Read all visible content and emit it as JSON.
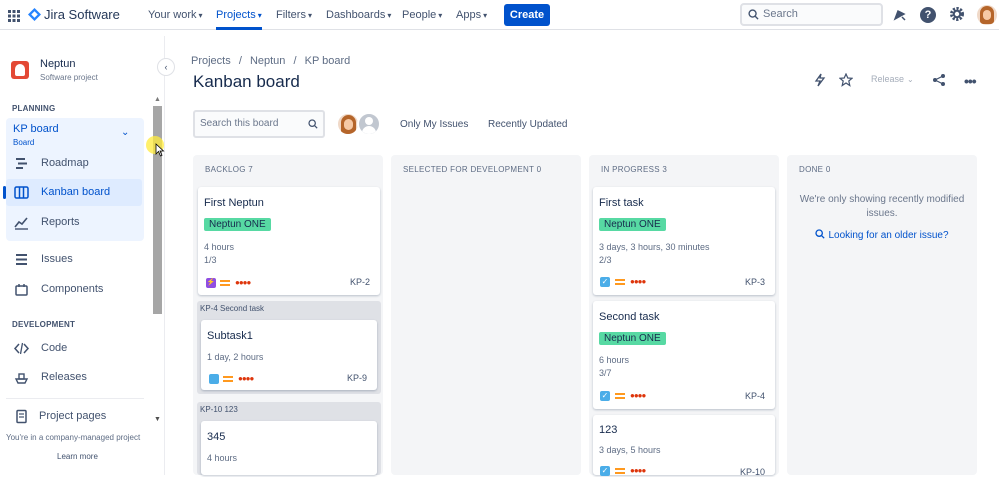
{
  "topnav": {
    "product": "Jira Software",
    "items": [
      {
        "label": "Your work"
      },
      {
        "label": "Projects"
      },
      {
        "label": "Filters"
      },
      {
        "label": "Dashboards"
      },
      {
        "label": "People"
      },
      {
        "label": "Apps"
      }
    ],
    "create_label": "Create",
    "search_placeholder": "Search"
  },
  "sidebar": {
    "project_name": "Neptun",
    "project_type": "Software project",
    "planning_heading": "PLANNING",
    "board_name": "KP board",
    "board_sub": "Board",
    "planning_items": [
      {
        "label": "Roadmap"
      },
      {
        "label": "Kanban board"
      },
      {
        "label": "Reports"
      }
    ],
    "other_items": [
      {
        "label": "Issues"
      },
      {
        "label": "Components"
      }
    ],
    "development_heading": "DEVELOPMENT",
    "development_items": [
      {
        "label": "Code"
      },
      {
        "label": "Releases"
      }
    ],
    "project_pages": "Project pages",
    "footer_note": "You're in a company-managed project",
    "learn_more": "Learn more"
  },
  "page": {
    "breadcrumb": [
      "Projects",
      "Neptun",
      "KP board"
    ],
    "title": "Kanban board",
    "release_label": "Release",
    "board_search_placeholder": "Search this board",
    "filter_only_mine": "Only My Issues",
    "filter_recent": "Recently Updated"
  },
  "columns": [
    {
      "name": "BACKLOG 7"
    },
    {
      "name": "SELECTED FOR DEVELOPMENT 0"
    },
    {
      "name": "IN PROGRESS 3"
    },
    {
      "name": "DONE 0"
    }
  ],
  "backlog": {
    "card1": {
      "title": "First Neptun",
      "epic": "Neptun ONE",
      "estimate": "4 hours",
      "progress": "1/3",
      "key": "KP-2"
    },
    "parent1": {
      "label": "KP-4 Second task",
      "title": "Subtask1",
      "estimate": "1 day, 2 hours",
      "key": "KP-9"
    },
    "parent2": {
      "label": "KP-10 123",
      "title": "345",
      "estimate": "4 hours"
    }
  },
  "in_progress": {
    "card1": {
      "title": "First task",
      "epic": "Neptun ONE",
      "estimate": "3 days, 3 hours, 30 minutes",
      "progress": "2/3",
      "key": "KP-3"
    },
    "card2": {
      "title": "Second task",
      "epic": "Neptun ONE",
      "estimate": "6 hours",
      "progress": "3/7",
      "key": "KP-4"
    },
    "card3": {
      "title": "123",
      "estimate": "3 days, 5 hours",
      "key": "KP-10"
    }
  },
  "done": {
    "message": "We're only showing recently modified issues.",
    "link": "Looking for an older issue?"
  },
  "colors": {
    "accent": "#0052cc",
    "epic": "#57d9a3",
    "priority": "#ff991f",
    "critical": "#de350b"
  }
}
